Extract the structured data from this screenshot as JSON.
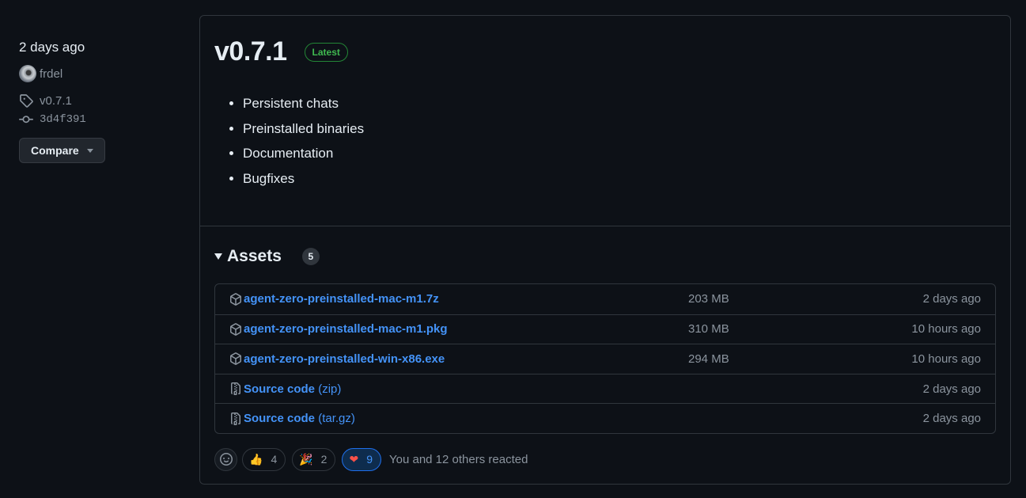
{
  "sidebar": {
    "date": "2 days ago",
    "author": "frdel",
    "tag": "v0.7.1",
    "commit": "3d4f391",
    "compare_label": "Compare"
  },
  "release": {
    "version": "v0.7.1",
    "badge": "Latest",
    "notes": [
      "Persistent chats",
      "Preinstalled binaries",
      "Documentation",
      "Bugfixes"
    ]
  },
  "assets": {
    "title": "Assets",
    "count": "5",
    "items": [
      {
        "name": "agent-zero-preinstalled-mac-m1.7z",
        "ext": "",
        "size": "203 MB",
        "date": "2 days ago",
        "icon": "package-icon"
      },
      {
        "name": "agent-zero-preinstalled-mac-m1.pkg",
        "ext": "",
        "size": "310 MB",
        "date": "10 hours ago",
        "icon": "package-icon"
      },
      {
        "name": "agent-zero-preinstalled-win-x86.exe",
        "ext": "",
        "size": "294 MB",
        "date": "10 hours ago",
        "icon": "package-icon"
      },
      {
        "name": "Source code",
        "ext": " (zip)",
        "size": "",
        "date": "2 days ago",
        "icon": "file-zip-icon"
      },
      {
        "name": "Source code",
        "ext": " (tar.gz)",
        "size": "",
        "date": "2 days ago",
        "icon": "file-zip-icon"
      }
    ]
  },
  "reactions": {
    "thumbs_up": "4",
    "tada": "2",
    "heart": "9",
    "summary": "You and 12 others reacted"
  },
  "colors": {
    "background": "#0d1117",
    "link": "#4493f8",
    "latest": "#3fb950",
    "border": "#30363d"
  }
}
